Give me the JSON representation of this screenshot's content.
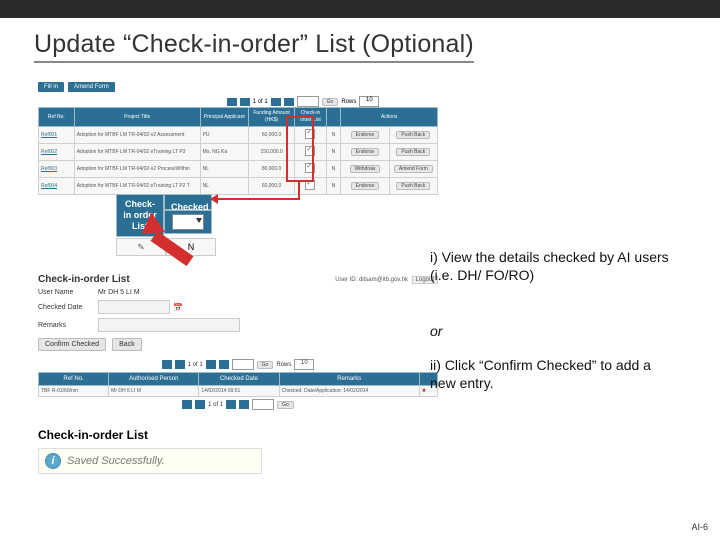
{
  "slide": {
    "title": "Update “Check-in-order” List (Optional)",
    "page_number": "AI-6"
  },
  "instructions": {
    "i1": "i) View the details checked by AI users (i.e. DH/ FO/RO)",
    "or": "or",
    "i2": "ii) Click “Confirm Checked” to add a new entry."
  },
  "shot1": {
    "tabs": [
      "Fill in",
      "Amend Form"
    ],
    "pager": {
      "text": "1 of 1",
      "go": "Go",
      "rows_label": "Rows",
      "rows_value": "10"
    },
    "columns": [
      "Ref No.",
      "Project Title",
      "Principal Applicant",
      "Funding Amount (HK$)",
      "Check-in order List",
      "",
      "Actions",
      ""
    ],
    "rows": [
      {
        "ref": "Ref001",
        "title": "Adoption for MTBF LM TR-04/02-v2 Assessment",
        "pa": "PU",
        "amt": "60,000.0",
        "act1": "Endorse",
        "act2": "Push Back"
      },
      {
        "ref": "Ref002",
        "title": "Adoption for MTBF LM TR-04/02 eTraining LT P3",
        "pa": "Ms. NG Ka",
        "amt": "150,000.0",
        "act1": "Endorse",
        "act2": "Push Back"
      },
      {
        "ref": "Ref003",
        "title": "Adoption for MTBF LM TR-04/02-v2 ProcessWIthin",
        "pa": "NL",
        "amt": "80,000.0",
        "act1": "Withdraw",
        "act2": "Amend Form"
      },
      {
        "ref": "Ref004",
        "title": "Adoption for MTBF LM TR-04/02 eTraining LT P2 T",
        "pa": "NL",
        "amt": "60,000.0",
        "act1": "Endorse",
        "act2": "Push Back"
      }
    ]
  },
  "popout": {
    "col1": "Check-in order List",
    "col2": "Checked",
    "selected": "N"
  },
  "form": {
    "heading": "Check-in-order List",
    "user_line_prefix": "User ID: ditsam@itb.gov.hk",
    "logout": "Logout",
    "fields": {
      "user_name_label": "User Name",
      "user_name_value": "Mr DH 5 LI M",
      "checked_date_label": "Checked Date",
      "remarks_label": "Remarks"
    },
    "buttons": {
      "confirm": "Confirm Checked",
      "back": "Back"
    },
    "pagerB": {
      "text": "1 of 1",
      "go": "Go",
      "rows_label": "Rows",
      "rows_value": "10"
    },
    "tblB_columns": [
      "Ref No.",
      "Authorised Person",
      "Checked Date",
      "Remarks",
      ""
    ],
    "tblB_row": {
      "ref": "TBF R-01/60/nm",
      "person": "Mr DH 5 LI M",
      "date": "14/02/2014 09:51",
      "remarks": "Checked. Date/Application: 14/02/2014"
    }
  },
  "saved": {
    "heading": "Check-in-order List",
    "message": "Saved Successfully."
  }
}
